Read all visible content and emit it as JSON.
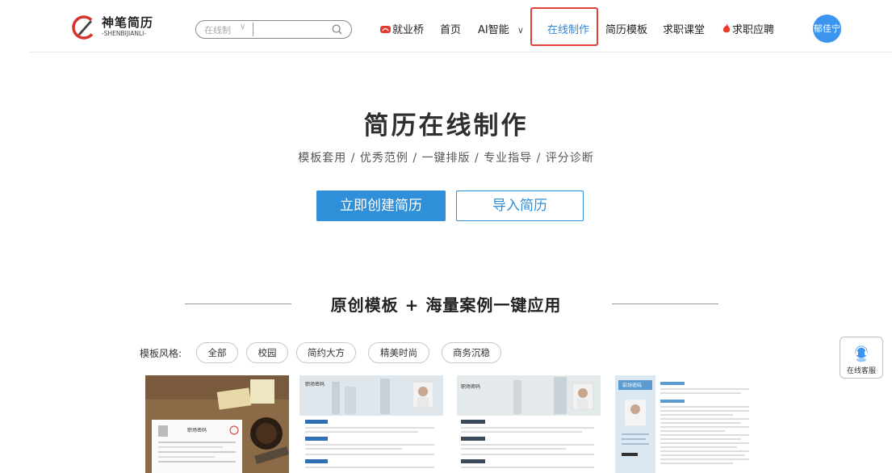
{
  "header": {
    "logo": {
      "name": "神笔简历",
      "subtitle": "-SHENBIJIANLI-"
    },
    "search": {
      "scope": "在线制",
      "placeholder": ""
    },
    "nav": [
      {
        "label": "就业桥",
        "icon": "bridge-icon"
      },
      {
        "label": "首页"
      },
      {
        "label": "AI智能",
        "icon": "chevron-down-icon"
      },
      {
        "label": "在线制作",
        "active": true
      },
      {
        "label": "简历模板"
      },
      {
        "label": "求职课堂"
      },
      {
        "label": "求职应聘",
        "icon": "flame-icon"
      }
    ],
    "user": {
      "name": "郁佳宁"
    }
  },
  "hero": {
    "title": "简历在线制作",
    "subtitle": "模板套用 / 优秀范例 / 一键排版 / 专业指导 / 评分诊断",
    "primary_button": "立即创建简历",
    "secondary_button": "导入简历"
  },
  "templates": {
    "section_title": "原创模板 + 海量案例一键应用",
    "filter_label": "模板风格:",
    "filters": [
      "全部",
      "校园",
      "简约大方",
      "精美时尚",
      "商务沉稳"
    ],
    "cards": [
      {
        "title": "职场密码",
        "style": "photo-desk"
      },
      {
        "title": "职场密码",
        "style": "city-header"
      },
      {
        "title": "职场密码",
        "style": "city-header"
      },
      {
        "title": "职场密码",
        "style": "sidebar-blue"
      }
    ]
  },
  "support": {
    "label": "在线客服",
    "icon": "headset-icon"
  },
  "colors": {
    "accent": "#2f8fd8",
    "active_border": "#e0413b",
    "avatar": "#3b95ef",
    "logo_red": "#d7322b"
  }
}
